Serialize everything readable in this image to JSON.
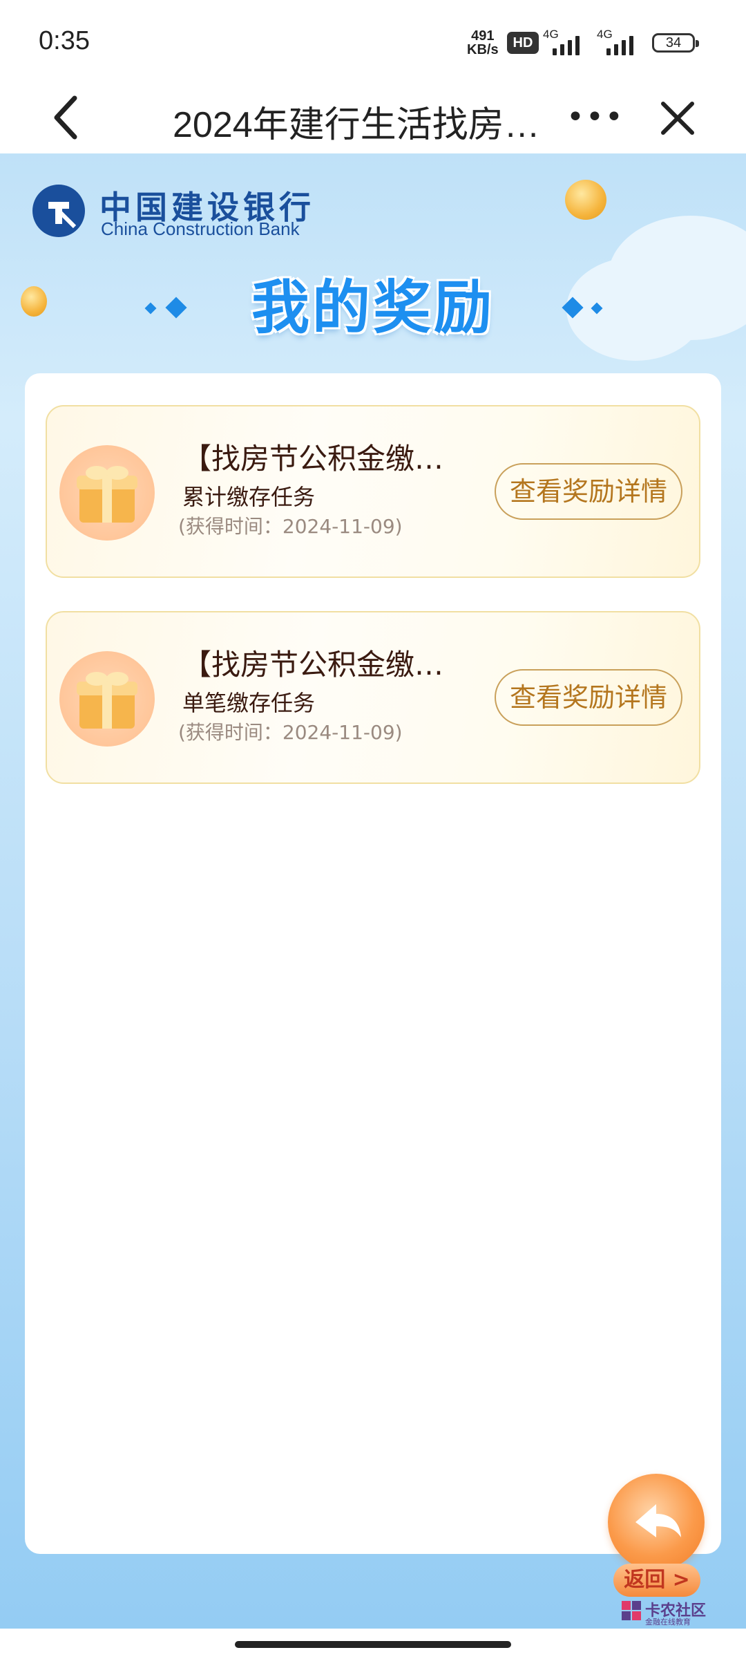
{
  "status_bar": {
    "time": "0:35",
    "net_speed_value": "491",
    "net_speed_unit": "KB/s",
    "hd_badge": "HD",
    "signal1_label": "4G",
    "signal2_label": "4G",
    "battery": "34"
  },
  "nav": {
    "title": "2024年建行生活找房…",
    "more_label": "•••"
  },
  "brand": {
    "name_cn": "中国建设银行",
    "name_en": "China Construction Bank"
  },
  "page": {
    "heading": "我的奖励"
  },
  "rewards": [
    {
      "title": "【找房节公积金缴…",
      "subtitle": "累计缴存任务",
      "date": "(获得时间：2024-11-09)",
      "button_label": "查看奖励详情"
    },
    {
      "title": "【找房节公积金缴…",
      "subtitle": "单笔缴存任务",
      "date": "(获得时间：2024-11-09)",
      "button_label": "查看奖励详情"
    }
  ],
  "return_button": {
    "label": "返回 >"
  },
  "watermark": {
    "name": "卡农社区",
    "tagline": "金融在线教育"
  },
  "colors": {
    "accent_blue": "#1d8ff0",
    "brand_blue": "#1a4f9c",
    "button_gold": "#b4761e",
    "fab_orange": "#f58a3c"
  }
}
